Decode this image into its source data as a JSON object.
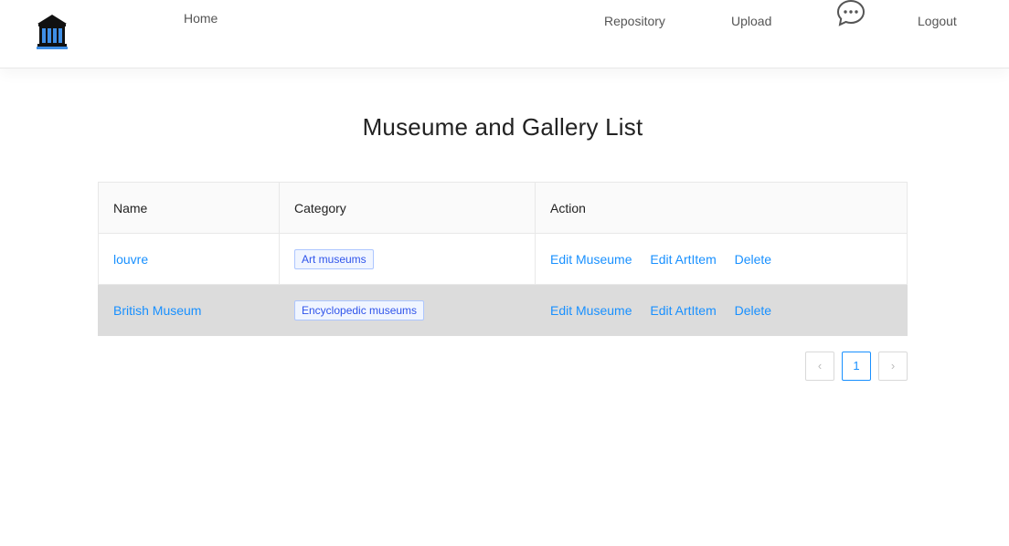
{
  "nav": {
    "home": "Home",
    "repository": "Repository",
    "upload": "Upload",
    "logout": "Logout",
    "logo_icon": "museum-building-icon",
    "chat_icon": "chat-bubble-icon"
  },
  "page": {
    "title": "Museume and Gallery List"
  },
  "table": {
    "headers": [
      "Name",
      "Category",
      "Action"
    ],
    "rows": [
      {
        "name": "louvre",
        "category": "Art museums",
        "actions": [
          "Edit Museume",
          "Edit ArtItem",
          "Delete"
        ]
      },
      {
        "name": "British Museum",
        "category": "Encyclopedic museums",
        "actions": [
          "Edit Museume",
          "Edit ArtItem",
          "Delete"
        ]
      }
    ]
  },
  "pagination": {
    "prev": "‹",
    "current": "1",
    "next": "›"
  },
  "colors": {
    "link": "#1890ff",
    "tag_text": "#2f54eb",
    "tag_bg": "#f0f5ff",
    "tag_border": "#adc6ff",
    "row_highlight": "#dcdcdc"
  }
}
